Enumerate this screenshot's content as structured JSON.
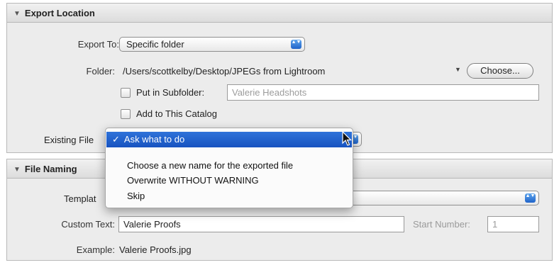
{
  "export_location": {
    "header": "Export Location",
    "export_to_label": "Export To:",
    "export_to_value": "Specific folder",
    "folder_label": "Folder:",
    "folder_path": "/Users/scottkelby/Desktop/JPEGs from Lightroom",
    "choose_button": "Choose...",
    "subfolder_label": "Put in Subfolder:",
    "subfolder_value": "Valerie Headshots",
    "add_catalog_label": "Add to This Catalog",
    "existing_files_label": "Existing File"
  },
  "existing_files_menu": {
    "check": "✓",
    "selected": "Ask what to do",
    "options": [
      "Choose a new name for the exported file",
      "Overwrite WITHOUT WARNING",
      "Skip"
    ]
  },
  "file_naming": {
    "header": "File Naming",
    "template_label": "Templat",
    "custom_text_label": "Custom Text:",
    "custom_text_value": "Valerie Proofs",
    "start_number_label": "Start Number:",
    "start_number_value": "1",
    "example_label": "Example:",
    "example_value": "Valerie Proofs.jpg"
  },
  "icons": {
    "triangle": "▼",
    "stepper": "▲▼",
    "dropdown": "▼"
  },
  "colors": {
    "accent": "#1f63c9",
    "panel_bg": "#ececec",
    "selection": "#2463cc"
  }
}
